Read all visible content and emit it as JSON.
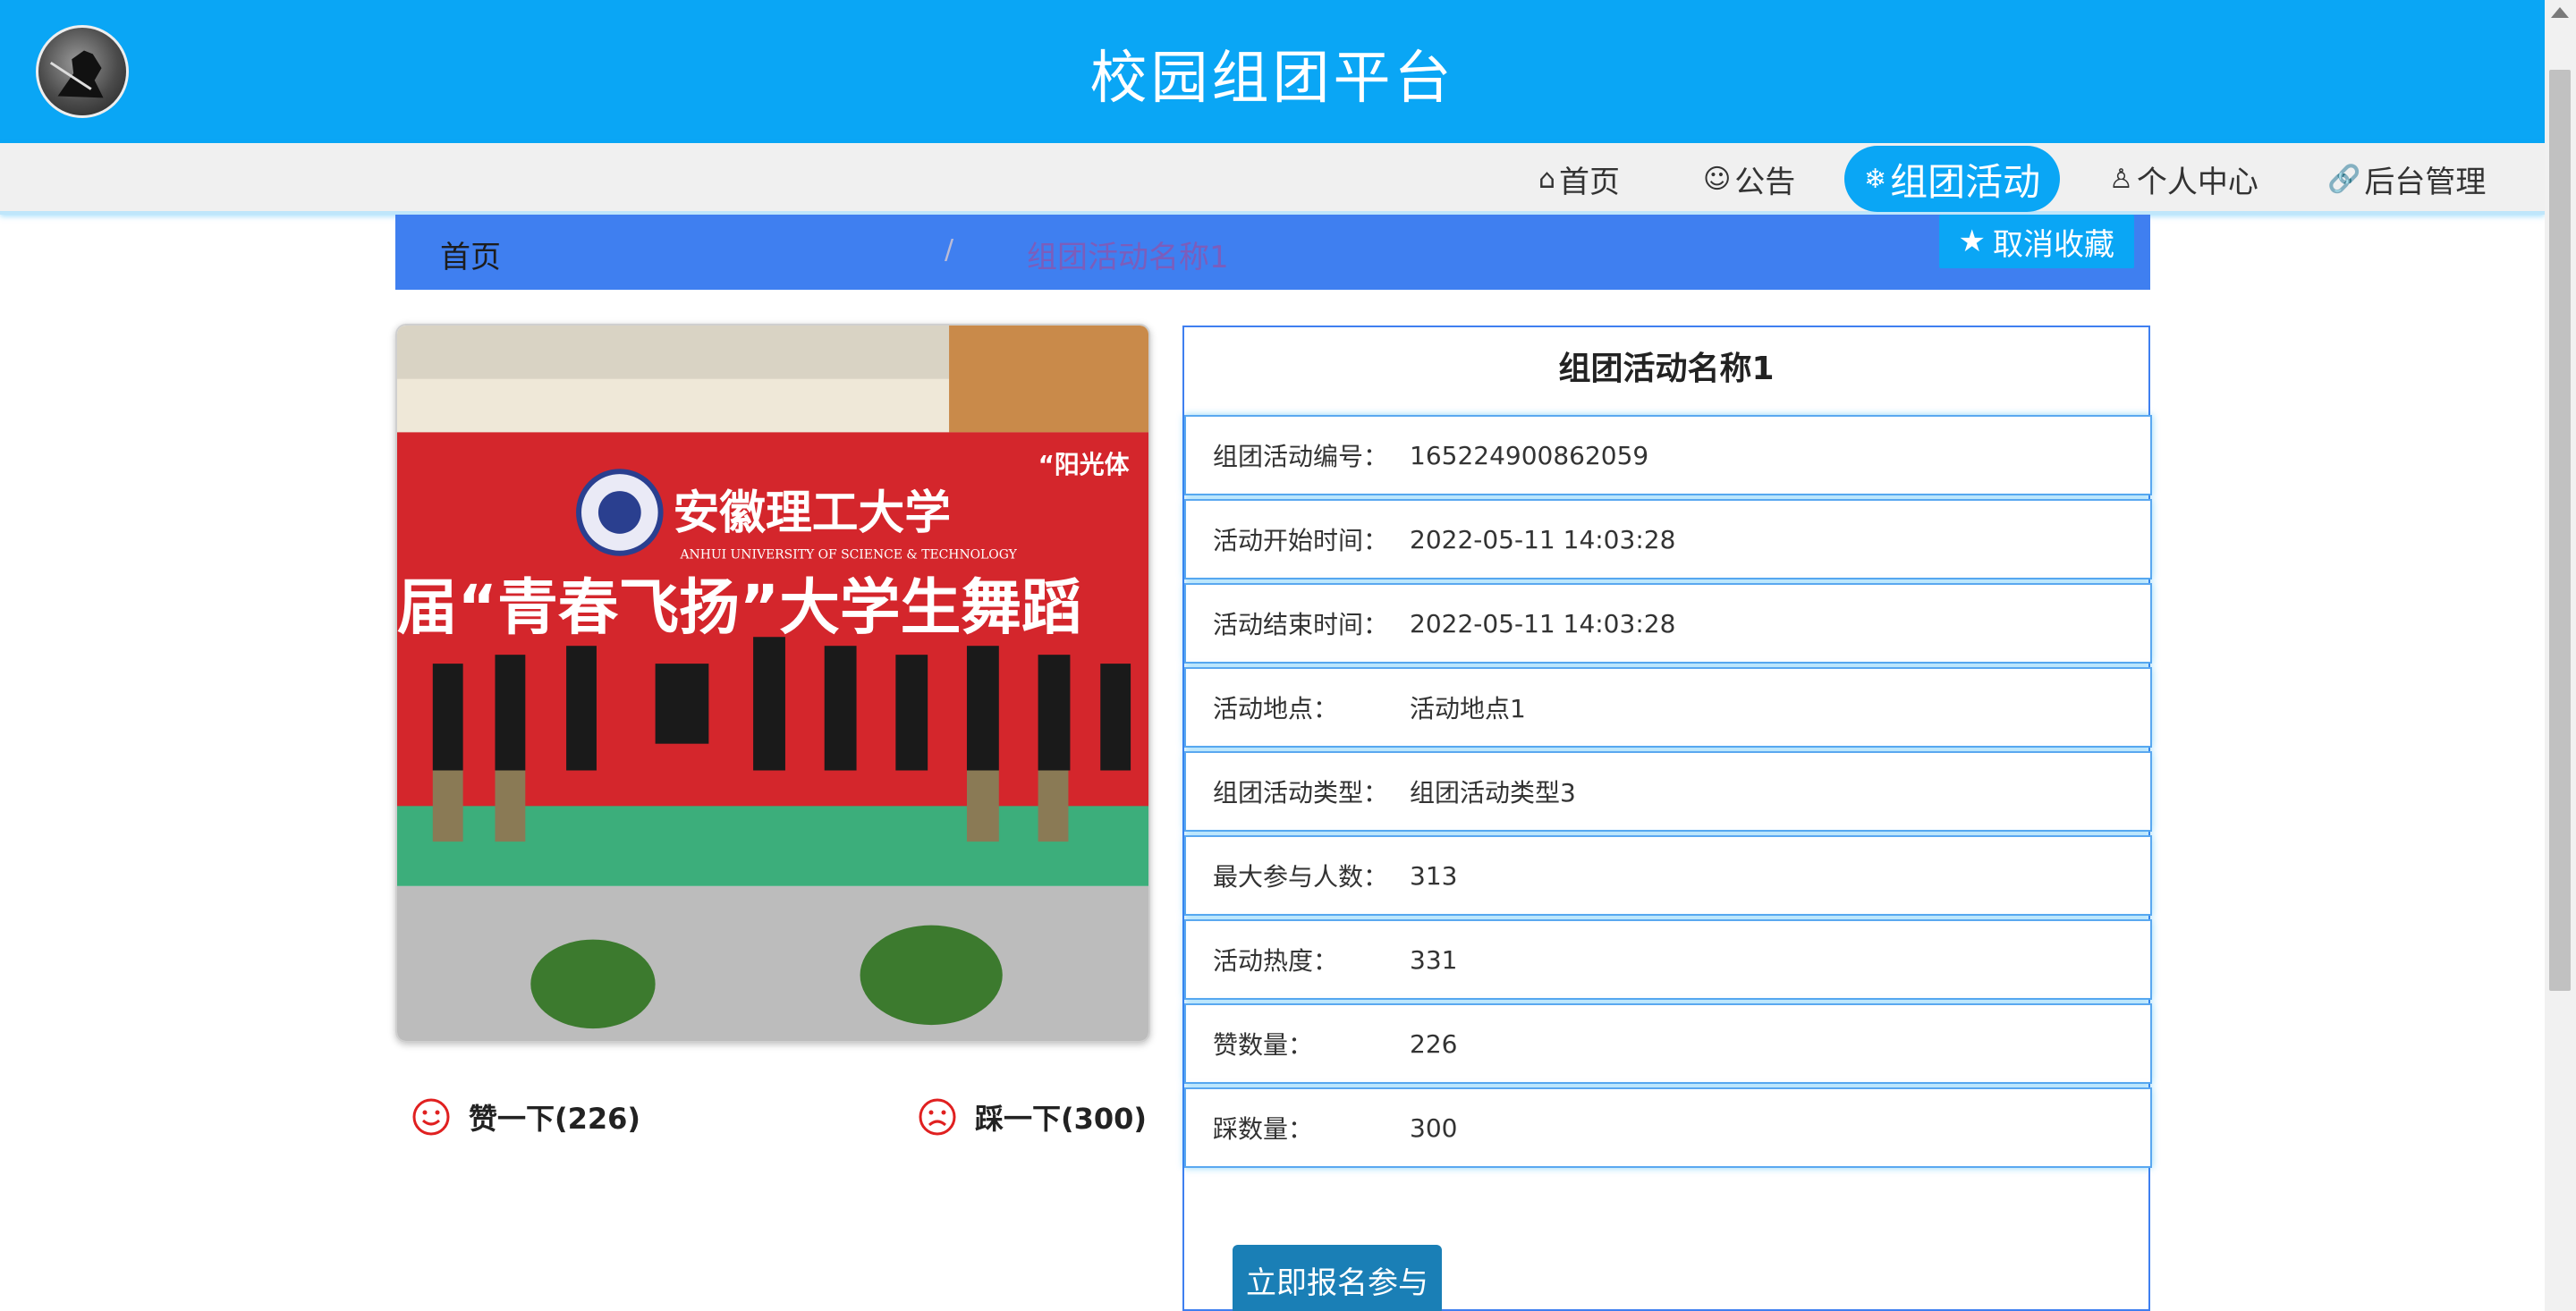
{
  "header": {
    "title": "校园组团平台"
  },
  "nav": {
    "items": [
      {
        "icon": "⌂",
        "label": "首页"
      },
      {
        "icon": "☺",
        "label": "公告"
      },
      {
        "icon": "❄",
        "label": "组团活动"
      },
      {
        "icon": "♙",
        "label": "个人中心"
      },
      {
        "icon": "🔗",
        "label": "后台管理"
      }
    ]
  },
  "breadcrumb": {
    "home": "首页",
    "separator": "/",
    "current": "组团活动名称1"
  },
  "favorite_button": {
    "icon": "★",
    "label": "取消收藏"
  },
  "photo": {
    "banner_cn": "安徽理工大学",
    "banner_en": "ANHUI UNIVERSITY OF SCIENCE & TECHNOLOGY",
    "slogan": "届“青春飞扬”大学生舞蹈",
    "corner": "“阳光体"
  },
  "votes": {
    "like_label": "赞一下(226)",
    "dislike_label": "踩一下(300)"
  },
  "detail": {
    "title": "组团活动名称1",
    "rows": [
      {
        "key": "组团活动编号：",
        "value": "165224900862059"
      },
      {
        "key": "活动开始时间：",
        "value": "2022-05-11 14:03:28"
      },
      {
        "key": "活动结束时间：",
        "value": "2022-05-11 14:03:28"
      },
      {
        "key": "活动地点：",
        "value": "活动地点1"
      },
      {
        "key": "组团活动类型：",
        "value": "组团活动类型3"
      },
      {
        "key": "最大参与人数：",
        "value": "313"
      },
      {
        "key": "活动热度：",
        "value": "331"
      },
      {
        "key": "赞数量：",
        "value": "226"
      },
      {
        "key": "踩数量：",
        "value": "300"
      }
    ],
    "join_label": "立即报名参与"
  },
  "colors": {
    "primary": "#0aa6f5",
    "breadcrumb_bg": "#3f7ff0",
    "join_button": "#1a7fb6",
    "vote_icon": "#e02020"
  }
}
